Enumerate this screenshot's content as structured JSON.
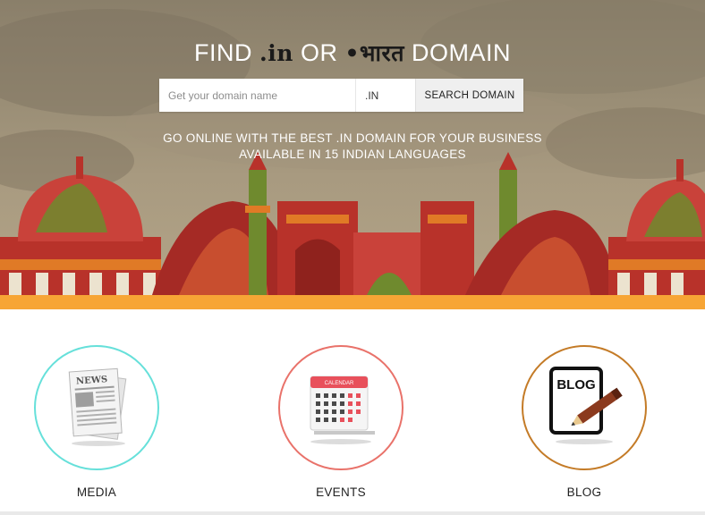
{
  "hero": {
    "headline_find": "FIND",
    "headline_brand_in": ".in",
    "headline_or": "OR",
    "headline_brand_bharat": "•भारत",
    "headline_domain": "DOMAIN",
    "tagline_line1": "GO ONLINE WITH THE BEST .IN DOMAIN FOR YOUR BUSINESS",
    "tagline_line2": "AVAILABLE IN 15 INDIAN LANGUAGES"
  },
  "search": {
    "placeholder": "Get your domain name",
    "value": "",
    "tld_selected": ".IN",
    "button_label": "SEARCH DOMAIN"
  },
  "features": [
    {
      "label": "MEDIA",
      "icon": "newspaper-icon",
      "ring_color": "#66e0da"
    },
    {
      "label": "EVENTS",
      "icon": "calendar-icon",
      "ring_color": "#e9726a",
      "calendar_header": "CALENDAR"
    },
    {
      "label": "BLOG",
      "icon": "blog-pencil-icon",
      "ring_color": "#c47b27",
      "badge_text": "BLOG",
      "newspaper_header": "NEWS"
    }
  ],
  "colors": {
    "accent_band": "#f7a535",
    "hero_bg": "#9a8e76",
    "skyline_red": "#b8322a",
    "skyline_green": "#6f8a2e",
    "skyline_orange": "#e07a26"
  }
}
